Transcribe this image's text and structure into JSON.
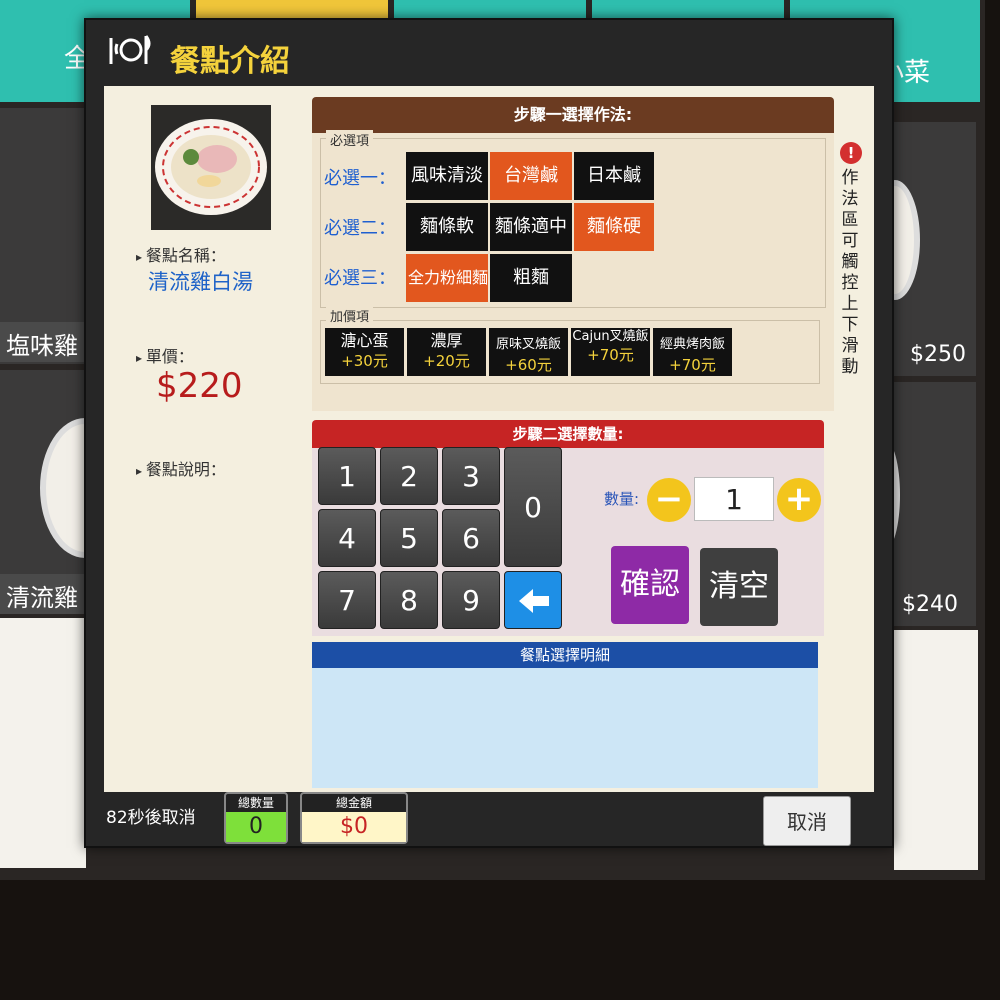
{
  "background": {
    "tabs": [
      "全",
      "",
      "",
      "",
      "小菜"
    ],
    "items": [
      {
        "name": "塩味雞",
        "price": "$250"
      },
      {
        "name": "清流雞",
        "price": "$240"
      }
    ]
  },
  "modal": {
    "title": "餐點介紹",
    "title_icon": "plate-cutlery-icon"
  },
  "dish": {
    "name_label": "餐點名稱：",
    "name": "清流雞白湯",
    "price_label": "單價：",
    "price": "$220",
    "desc_label": "餐點說明："
  },
  "step1": {
    "header": "步驟一選擇作法:",
    "required_legend": "必選項",
    "groups": [
      {
        "label": "必選一：",
        "options": [
          {
            "text": "風味清淡",
            "selected": false
          },
          {
            "text": "台灣鹹",
            "selected": true
          },
          {
            "text": "日本鹹",
            "selected": false
          }
        ]
      },
      {
        "label": "必選二：",
        "options": [
          {
            "text": "麵條軟",
            "selected": false
          },
          {
            "text": "麵條適中",
            "selected": false
          },
          {
            "text": "麵條硬",
            "selected": true
          }
        ]
      },
      {
        "label": "必選三：",
        "options": [
          {
            "text": "全力粉細麵",
            "selected": true
          },
          {
            "text": "粗麵",
            "selected": false
          }
        ]
      }
    ],
    "addon_legend": "加價項",
    "addons": [
      {
        "name": "溏心蛋",
        "price": "+30元"
      },
      {
        "name": "濃厚",
        "price": "+20元"
      },
      {
        "name": "原味叉燒飯",
        "price": "+60元"
      },
      {
        "name": "Cajun叉燒飯",
        "price": "+70元"
      },
      {
        "name": "經典烤肉飯",
        "price": "+70元"
      }
    ],
    "warning": "作法區可觸控上下滑動"
  },
  "step2": {
    "header": "步驟二選擇數量:",
    "keys": [
      "1",
      "2",
      "3",
      "4",
      "5",
      "6",
      "7",
      "8",
      "9",
      "0"
    ],
    "qty_label": "數量:",
    "qty_value": "1",
    "minus": "−",
    "plus": "+",
    "confirm": "確認",
    "clear": "清空"
  },
  "detail": {
    "header": "餐點選擇明細"
  },
  "footer": {
    "countdown": "82秒後取消",
    "total_qty_label": "總數量",
    "total_qty": "0",
    "total_amount_label": "總金額",
    "total_amount": "$0",
    "cancel": "取消"
  },
  "colors": {
    "accent_orange": "#e2571e",
    "step1_header": "#6b3b21",
    "step2_header": "#c62424",
    "detail_header": "#1c4fa6",
    "confirm": "#8e2aa6",
    "title": "#f4d23c"
  }
}
